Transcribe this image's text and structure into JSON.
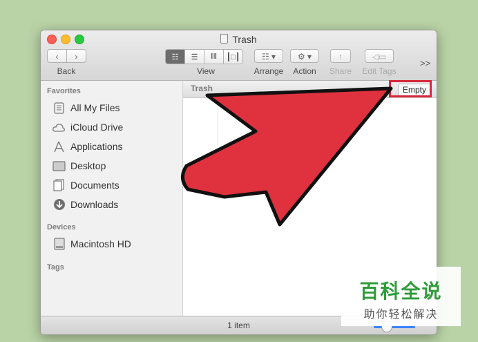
{
  "window": {
    "title": "Trash"
  },
  "toolbar": {
    "back_label": "Back",
    "view_label": "View",
    "arrange_label": "Arrange",
    "action_label": "Action",
    "share_label": "Share",
    "edit_tags_label": "Edit Tags",
    "overflow_label": ">>"
  },
  "sidebar": {
    "favorites_header": "Favorites",
    "favorites": [
      {
        "label": "All My Files",
        "icon": "all-files-icon"
      },
      {
        "label": "iCloud Drive",
        "icon": "cloud-icon"
      },
      {
        "label": "Applications",
        "icon": "applications-icon"
      },
      {
        "label": "Desktop",
        "icon": "desktop-icon"
      },
      {
        "label": "Documents",
        "icon": "documents-icon"
      },
      {
        "label": "Downloads",
        "icon": "downloads-icon"
      }
    ],
    "devices_header": "Devices",
    "devices": [
      {
        "label": "Macintosh HD",
        "icon": "hard-drive-icon"
      }
    ],
    "tags_header": "Tags"
  },
  "content": {
    "path_label": "Trash",
    "empty_button": "Empty",
    "highlight_color": "#d9263b"
  },
  "status": {
    "item_count": "1 item"
  },
  "annotation": {
    "arrow_color": "#e0313f"
  },
  "watermark": {
    "main": "百科全说",
    "sub": "助你轻松解决"
  }
}
